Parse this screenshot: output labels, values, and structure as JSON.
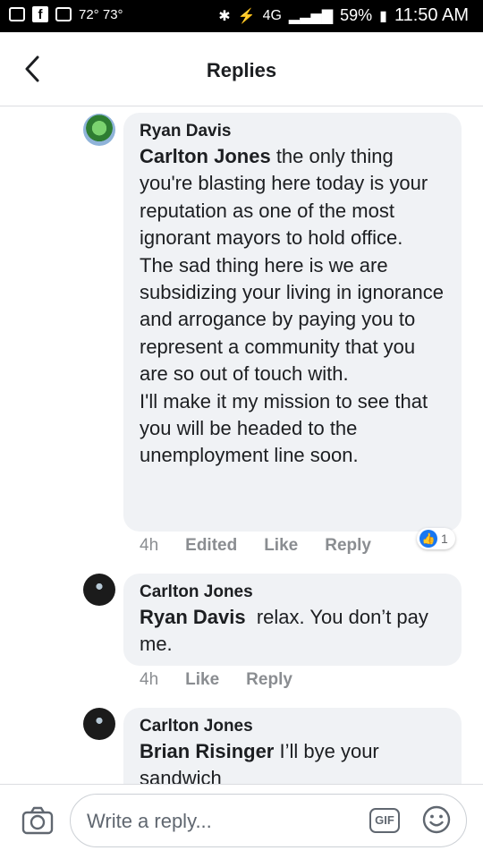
{
  "status_bar": {
    "temperature": "72° 73°",
    "network": "4G",
    "battery": "59%",
    "time": "11:50 AM"
  },
  "header": {
    "title": "Replies"
  },
  "comments": [
    {
      "author": "Ryan Davis",
      "mention": "Carlton Jones",
      "text": " the only thing you're blasting here today is your reputation as one of the most ignorant mayors to hold office.\nThe sad thing here is we are subsidizing your living in ignorance and arrogance by paying you to represent a community that you are so out of touch with.\nI'll make it my mission to see that you will be headed to the unemployment line soon.",
      "age": "4h",
      "edited": "Edited",
      "like_label": "Like",
      "reply_label": "Reply",
      "reaction_count": "1"
    },
    {
      "author": "Carlton Jones",
      "mention": "Ryan Davis",
      "text": "  relax. You don’t pay me.",
      "age": "4h",
      "like_label": "Like",
      "reply_label": "Reply"
    },
    {
      "author": "Carlton Jones",
      "mention": "Brian Risinger",
      "text": " I’ll bye your sandwich"
    }
  ],
  "reply_bar": {
    "placeholder": "Write a reply...",
    "gif_label": "GIF"
  }
}
